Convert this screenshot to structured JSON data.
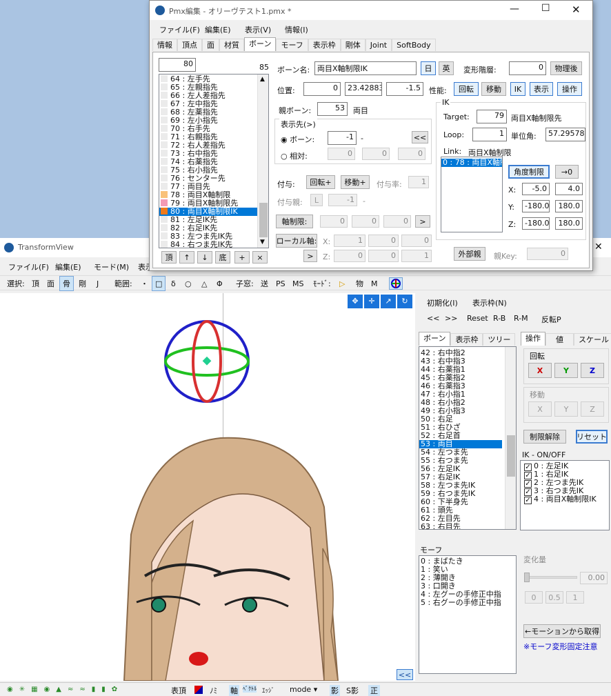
{
  "pmx": {
    "title": "Pmx編集 - オリーヴテスト1.pmx *",
    "menu": [
      "ファイル(F)",
      "編集(E)",
      "表示(V)",
      "情報(I)"
    ],
    "tabs": [
      "情報",
      "頂点",
      "面",
      "材質",
      "ボーン",
      "モーフ",
      "表示枠",
      "剛体",
      "Joint",
      "SoftBody"
    ],
    "active_tab": "ボーン",
    "bone_count_input": "80",
    "bone_total": "85",
    "bone_list": [
      {
        "label": "64 : 左手先",
        "color": "#ebebeb"
      },
      {
        "label": "65 : 左親指先",
        "color": "#ebebeb"
      },
      {
        "label": "66 : 左人差指先",
        "color": "#ebebeb"
      },
      {
        "label": "67 : 左中指先",
        "color": "#ebebeb"
      },
      {
        "label": "68 : 左薬指先",
        "color": "#ebebeb"
      },
      {
        "label": "69 : 左小指先",
        "color": "#ebebeb"
      },
      {
        "label": "70 : 右手先",
        "color": "#ebebeb"
      },
      {
        "label": "71 : 右親指先",
        "color": "#ebebeb"
      },
      {
        "label": "72 : 右人差指先",
        "color": "#ebebeb"
      },
      {
        "label": "73 : 右中指先",
        "color": "#ebebeb"
      },
      {
        "label": "74 : 右薬指先",
        "color": "#ebebeb"
      },
      {
        "label": "75 : 右小指先",
        "color": "#ebebeb"
      },
      {
        "label": "76 : センター先",
        "color": "#ebebeb"
      },
      {
        "label": "77 : 両目先",
        "color": "#ebebeb"
      },
      {
        "label": "78 : 両目X軸制限",
        "color": "#f9c27a"
      },
      {
        "label": "79 : 両目X軸制限先",
        "color": "#f49bb5"
      },
      {
        "label": "80 : 両目X軸制限IK",
        "color": "#f07a1a",
        "selected": true
      },
      {
        "label": "81 : 左足IK先",
        "color": "#ebebeb"
      },
      {
        "label": "82 : 右足IK先",
        "color": "#ebebeb"
      },
      {
        "label": "83 : 左つま先IK先",
        "color": "#ebebeb"
      },
      {
        "label": "84 : 右つま先IK先",
        "color": "#ebebeb"
      }
    ],
    "list_buttons": [
      "頂",
      "↑",
      "↓",
      "底",
      "+",
      "×"
    ],
    "bone_name_label": "ボーン名:",
    "bone_name": "両目X軸制限IK",
    "lang_jp": "日",
    "lang_en": "英",
    "deform_label": "変形階層:",
    "deform_value": "0",
    "physics_after": "物理後",
    "position_label": "位置:",
    "pos": [
      "0",
      "23.42883",
      "-1.5"
    ],
    "perf_label": "性能:",
    "perf": [
      "回転",
      "移動",
      "IK",
      "表示",
      "操作"
    ],
    "parent_label": "親ボーン:",
    "parent_value": "53",
    "parent_name": "両目",
    "display_dest": "表示先(>)",
    "radio_bone": "ボーン:",
    "radio_bone_value": "-1",
    "radio_bone_dash": "-",
    "prev_btn": "<<",
    "radio_rel": "相対:",
    "rel": [
      "0",
      "0",
      "0"
    ],
    "grant_label": "付与:",
    "grant_rot": "回転+",
    "grant_move": "移動+",
    "grant_rate_label": "付与率:",
    "grant_rate": "1",
    "grant_parent_label": "付与親:",
    "grant_L": "L",
    "grant_parent_value": "-1",
    "grant_dash": "-",
    "axis_limit": "軸制限:",
    "axis_vals": [
      "0",
      "0",
      "0"
    ],
    "axis_btn": ">",
    "local_axis": "ローカル軸:",
    "local_x_label": "X:",
    "local_x": [
      "1",
      "0",
      "0"
    ],
    "local_z_label": "Z:",
    "local_z": [
      "0",
      "0",
      "1"
    ],
    "local_btn": ">",
    "ik_label": "IK",
    "target_label": "Target:",
    "target_value": "79",
    "target_name": "両目X軸制限先",
    "loop_label": "Loop:",
    "loop_value": "1",
    "unit_label": "単位角:",
    "unit_value": "57.29578",
    "link_label": "Link:",
    "link_name": "両目X軸制限",
    "link_item": "0 : 78 : 両目X軸制",
    "angle_limit": "角度制限",
    "to_zero": "→0",
    "x_label": "X:",
    "x_vals": [
      "-5.0",
      "4.0"
    ],
    "y_label": "Y:",
    "y_vals": [
      "-180.0",
      "180.0"
    ],
    "z_label": "Z:",
    "z_vals": [
      "-180.0",
      "180.0"
    ],
    "external_parent": "外部親",
    "parent_key_label": "親Key:",
    "parent_key": "0"
  },
  "tv": {
    "title": "TransformView",
    "menu": [
      "ファイル(F)",
      "編集(E)",
      "モード(M)",
      "表示"
    ],
    "toolbar": [
      "選択:",
      "頂",
      "面",
      "骨",
      "剛",
      "J",
      "範囲:",
      "・",
      "□",
      "δ",
      "○",
      "△",
      "Φ",
      "子窓:",
      "送",
      "PS",
      "MS",
      "ﾓｰﾄﾞ:",
      "▷",
      "物",
      "M"
    ],
    "right_top": [
      "初期化(I)",
      "表示枠(N)"
    ],
    "nav": [
      "<<",
      ">>",
      "Reset",
      "R-B",
      "R-M",
      "反転P"
    ],
    "list_tabs": [
      "ボーン",
      "表示枠",
      "ツリー"
    ],
    "op_tabs": [
      "操作",
      "値",
      "スケール"
    ],
    "bones": [
      "42 : 右中指2",
      "43 : 右中指3",
      "44 : 右薬指1",
      "45 : 右薬指2",
      "46 : 右薬指3",
      "47 : 右小指1",
      "48 : 右小指2",
      "49 : 右小指3",
      "50 : 右足",
      "51 : 右ひざ",
      "52 : 右足首",
      "53 : 両目",
      "54 : 左つま先",
      "55 : 右つま先",
      "56 : 左足IK",
      "57 : 右足IK",
      "58 : 左つま先IK",
      "59 : 右つま先IK",
      "60 : 下半身先",
      "61 : 頭先",
      "62 : 左目先",
      "63 : 右目先"
    ],
    "selected_bone": "53 : 両目",
    "rot_label": "回転",
    "rot": [
      "X",
      "Y",
      "Z"
    ],
    "move_label": "移動",
    "move": [
      "X",
      "Y",
      "Z"
    ],
    "release": "制限解除",
    "reset": "リセット",
    "ik_onoff": "IK - ON/OFF",
    "ik_list": [
      "0 : 左足IK",
      "1 : 右足IK",
      "2 : 左つま先IK",
      "3 : 右つま先IK",
      "4 : 両目X軸制限IK"
    ],
    "morph_label": "モーフ",
    "morphs": [
      "0 : まばたき",
      "1 : 笑い",
      "2 : 薄開き",
      "3 : 口開き",
      "4 : 左グーの手修正中指",
      "5 : 右グーの手修正中指"
    ],
    "amount_label": "変化量",
    "amount_value": "0.00",
    "amount_btns": [
      "0",
      "0.5",
      "1"
    ],
    "from_motion": "←モーションから取得",
    "note": "※モーフ変形固定注意",
    "collapse": "<<",
    "status": [
      "表頂",
      "ﾉﾐ",
      "軸",
      "ﾍﾞｸﾄﾙ",
      "ｴｯｼﾞ",
      "mode ▾",
      "影",
      "S影",
      "正"
    ]
  },
  "colors": {
    "accent": "#0078d7",
    "red": "#cc0000",
    "green": "#009900",
    "blue": "#0000cc",
    "note": "#0000cc",
    "skin": "#f5d5c0",
    "hair": "#d2b08e"
  }
}
